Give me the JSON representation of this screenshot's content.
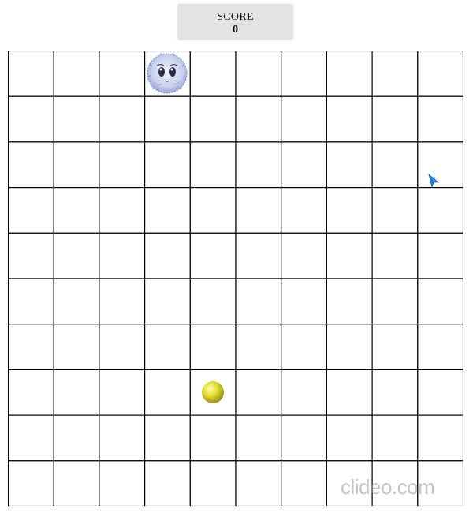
{
  "score": {
    "label": "SCORE",
    "value": "0"
  },
  "board": {
    "rows": 10,
    "cols": 10,
    "line_color": "#000000",
    "background_color": "#ffffff"
  },
  "player": {
    "sprite": "fluffy-puffball-character-icon",
    "row": 0,
    "col": 3,
    "color": "#c9d2ef"
  },
  "ball": {
    "sprite": "yellow-ball-icon",
    "row": 7,
    "col": 4,
    "color": "#e8e23a"
  },
  "cursor": {
    "icon": "pointer-arrow-icon",
    "color": "#1e88e5"
  },
  "watermark": {
    "text": "clideo.com"
  }
}
